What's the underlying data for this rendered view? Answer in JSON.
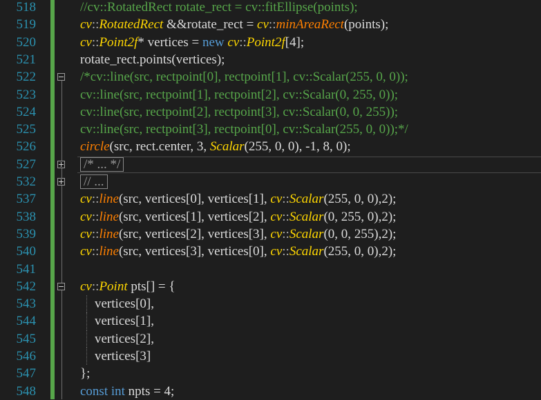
{
  "editor": {
    "lines": [
      {
        "num": "518",
        "tokens": [
          {
            "c": "c",
            "t": "//cv::RotatedRect rotate_rect = cv::fitEllipse(points);"
          }
        ]
      },
      {
        "num": "519",
        "tokens": [
          {
            "c": "t",
            "t": "cv"
          },
          {
            "c": "p",
            "t": "::"
          },
          {
            "c": "t",
            "t": "RotatedRect"
          },
          {
            "c": "n",
            "t": " &&rotate_rect = "
          },
          {
            "c": "t",
            "t": "cv"
          },
          {
            "c": "p",
            "t": "::"
          },
          {
            "c": "f",
            "t": "minAreaRect"
          },
          {
            "c": "n",
            "t": "(points);"
          }
        ]
      },
      {
        "num": "520",
        "tokens": [
          {
            "c": "t",
            "t": "cv"
          },
          {
            "c": "p",
            "t": "::"
          },
          {
            "c": "t",
            "t": "Point2f"
          },
          {
            "c": "n",
            "t": "* vertices = "
          },
          {
            "c": "k",
            "t": "new"
          },
          {
            "c": "n",
            "t": " "
          },
          {
            "c": "t",
            "t": "cv"
          },
          {
            "c": "p",
            "t": "::"
          },
          {
            "c": "t",
            "t": "Point2f"
          },
          {
            "c": "n",
            "t": "[4];"
          }
        ]
      },
      {
        "num": "521",
        "tokens": [
          {
            "c": "n",
            "t": "rotate_rect.points(vertices);"
          }
        ]
      },
      {
        "num": "522",
        "tokens": [
          {
            "c": "c",
            "t": "/*cv::line(src, rectpoint[0], rectpoint[1], cv::Scalar(255, 0, 0));"
          }
        ]
      },
      {
        "num": "523",
        "tokens": [
          {
            "c": "c",
            "t": "cv::line(src, rectpoint[1], rectpoint[2], cv::Scalar(0, 255, 0));"
          }
        ]
      },
      {
        "num": "524",
        "tokens": [
          {
            "c": "c",
            "t": "cv::line(src, rectpoint[2], rectpoint[3], cv::Scalar(0, 0, 255));"
          }
        ]
      },
      {
        "num": "525",
        "tokens": [
          {
            "c": "c",
            "t": "cv::line(src, rectpoint[3], rectpoint[0], cv::Scalar(255, 0, 0));*/"
          }
        ]
      },
      {
        "num": "526",
        "tokens": [
          {
            "c": "f",
            "t": "circle"
          },
          {
            "c": "n",
            "t": "(src, rect.center, 3, "
          },
          {
            "c": "t",
            "t": "Scalar"
          },
          {
            "c": "n",
            "t": "(255, 0, 0), -1, 8, 0);"
          }
        ]
      },
      {
        "num": "527",
        "collapsed": "/* ... */"
      },
      {
        "num": "532",
        "collapsed": "// ..."
      },
      {
        "num": "537",
        "tokens": [
          {
            "c": "t",
            "t": "cv"
          },
          {
            "c": "p",
            "t": "::"
          },
          {
            "c": "f",
            "t": "line"
          },
          {
            "c": "n",
            "t": "(src, vertices[0], vertices[1], "
          },
          {
            "c": "t",
            "t": "cv"
          },
          {
            "c": "p",
            "t": "::"
          },
          {
            "c": "t",
            "t": "Scalar"
          },
          {
            "c": "n",
            "t": "(255, 0, 0),2);"
          }
        ]
      },
      {
        "num": "538",
        "tokens": [
          {
            "c": "t",
            "t": "cv"
          },
          {
            "c": "p",
            "t": "::"
          },
          {
            "c": "f",
            "t": "line"
          },
          {
            "c": "n",
            "t": "(src, vertices[1], vertices[2], "
          },
          {
            "c": "t",
            "t": "cv"
          },
          {
            "c": "p",
            "t": "::"
          },
          {
            "c": "t",
            "t": "Scalar"
          },
          {
            "c": "n",
            "t": "(0, 255, 0),2);"
          }
        ]
      },
      {
        "num": "539",
        "tokens": [
          {
            "c": "t",
            "t": "cv"
          },
          {
            "c": "p",
            "t": "::"
          },
          {
            "c": "f",
            "t": "line"
          },
          {
            "c": "n",
            "t": "(src, vertices[2], vertices[3], "
          },
          {
            "c": "t",
            "t": "cv"
          },
          {
            "c": "p",
            "t": "::"
          },
          {
            "c": "t",
            "t": "Scalar"
          },
          {
            "c": "n",
            "t": "(0, 0, 255),2);"
          }
        ]
      },
      {
        "num": "540",
        "tokens": [
          {
            "c": "t",
            "t": "cv"
          },
          {
            "c": "p",
            "t": "::"
          },
          {
            "c": "f",
            "t": "line"
          },
          {
            "c": "n",
            "t": "(src, vertices[3], vertices[0], "
          },
          {
            "c": "t",
            "t": "cv"
          },
          {
            "c": "p",
            "t": "::"
          },
          {
            "c": "t",
            "t": "Scalar"
          },
          {
            "c": "n",
            "t": "(255, 0, 0),2);"
          }
        ]
      },
      {
        "num": "541",
        "tokens": []
      },
      {
        "num": "542",
        "tokens": [
          {
            "c": "t",
            "t": "cv"
          },
          {
            "c": "p",
            "t": "::"
          },
          {
            "c": "t",
            "t": "Point"
          },
          {
            "c": "n",
            "t": " pts[] = {"
          }
        ]
      },
      {
        "num": "543",
        "tokens": [
          {
            "c": "n",
            "t": "vertices[0],"
          }
        ]
      },
      {
        "num": "544",
        "tokens": [
          {
            "c": "n",
            "t": "vertices[1],"
          }
        ]
      },
      {
        "num": "545",
        "tokens": [
          {
            "c": "n",
            "t": "vertices[2],"
          }
        ]
      },
      {
        "num": "546",
        "tokens": [
          {
            "c": "n",
            "t": "vertices[3]"
          }
        ]
      },
      {
        "num": "547",
        "tokens": [
          {
            "c": "n",
            "t": "};"
          }
        ]
      },
      {
        "num": "548",
        "tokens": [
          {
            "c": "k",
            "t": "const"
          },
          {
            "c": "n",
            "t": " "
          },
          {
            "c": "k",
            "t": "int"
          },
          {
            "c": "n",
            "t": " npts = 4;"
          }
        ]
      }
    ]
  },
  "colors": {
    "background": "#1e1e1e",
    "line_number": "#2b91af",
    "comment": "#57a64a",
    "type": "#ffd700",
    "function": "#ff8000",
    "keyword": "#569cd6",
    "text": "#dcdcdc",
    "change_bar": "#57a64a"
  }
}
